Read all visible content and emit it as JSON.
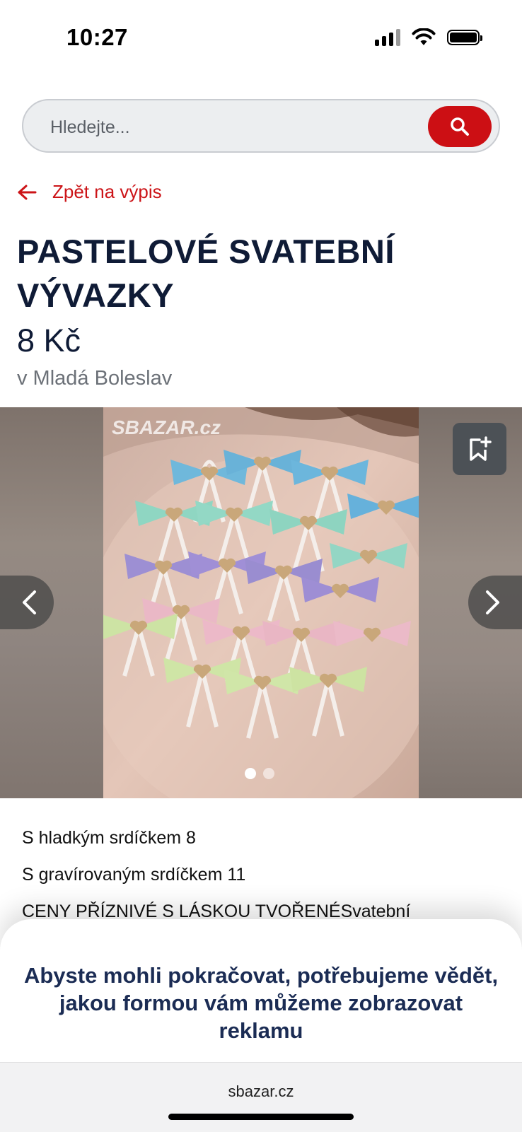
{
  "status_bar": {
    "time": "10:27"
  },
  "search": {
    "placeholder": "Hledejte..."
  },
  "back_link": {
    "label": "Zpět na výpis"
  },
  "listing": {
    "title": "PASTELOVÉ SVATEBNÍ VÝVAZKY",
    "price": "8 Kč",
    "location": "v Mladá Boleslav"
  },
  "gallery": {
    "watermark": "SBAZAR.cz",
    "image_count": 2,
    "current_index": 1
  },
  "description": {
    "lines": [
      "S hladkým srdíčkem 8",
      "S gravírovaným srdíčkem 11",
      "CENY PŘÍZNIVÉ S LÁSKOU TVOŘENÉSvatební"
    ]
  },
  "consent": {
    "message": "Abyste mohli pokračovat, potřebujeme vědět, jakou formou vám můžeme zobrazovat reklamu"
  },
  "browser": {
    "url": "sbazar.cz"
  },
  "colors": {
    "accent": "#cc0f14",
    "title": "#0f1b36",
    "muted": "#6c7178",
    "consent_text": "#1b2c54"
  }
}
